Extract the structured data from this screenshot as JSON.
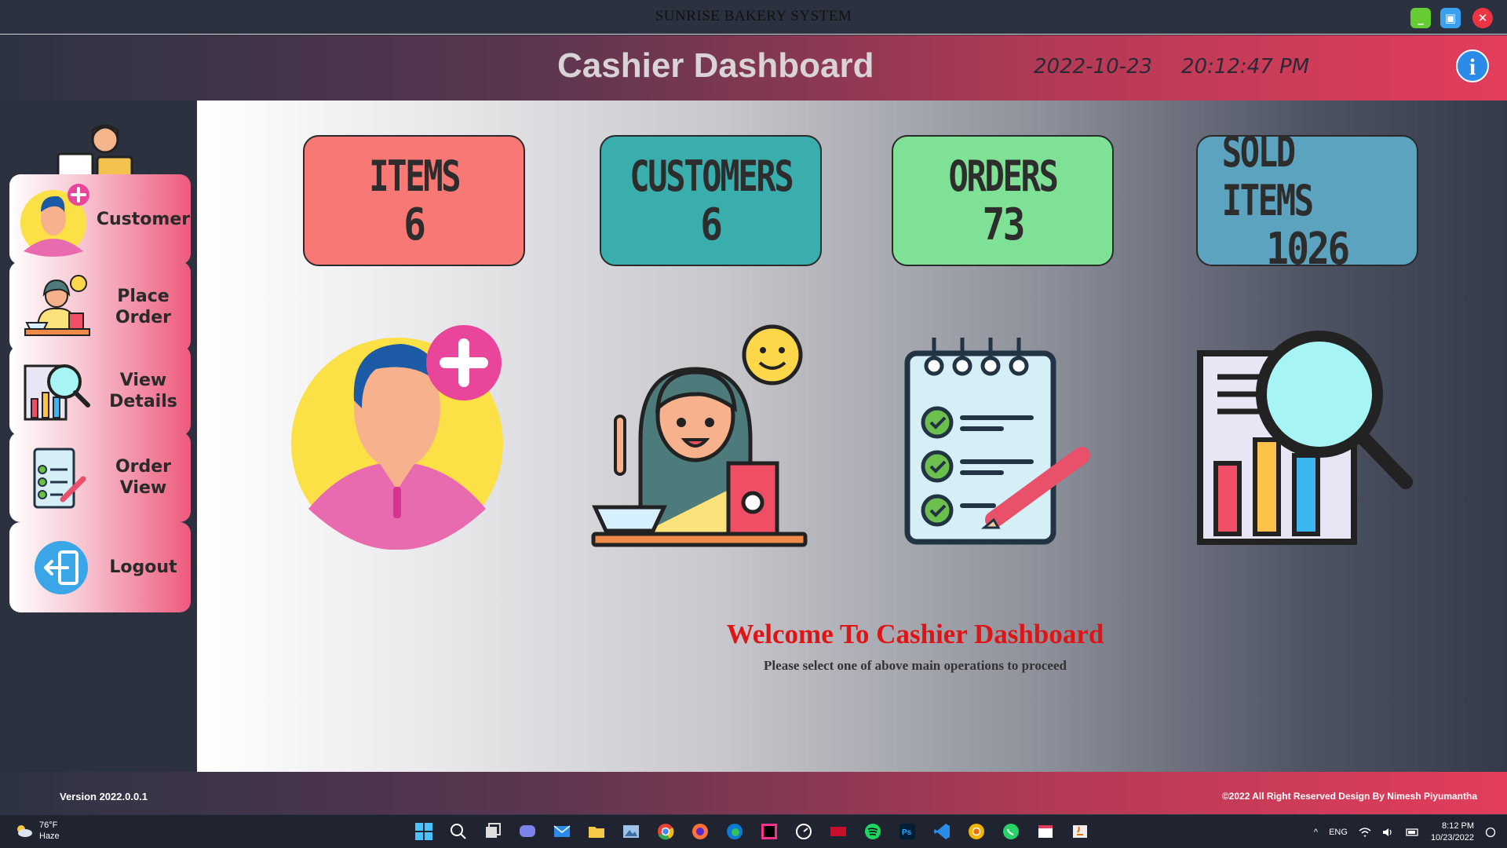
{
  "window": {
    "title": "SUNRISE BAKERY SYSTEM",
    "minimize_icon": "minimize-icon",
    "maximize_icon": "maximize-icon",
    "close_icon": "close-icon"
  },
  "header": {
    "title": "Cashier Dashboard",
    "date": "2022-10-23",
    "time": "20:12:47 PM",
    "info_label": "i"
  },
  "sidebar": {
    "logo_icon": "cashier-icon",
    "items": [
      {
        "label": "Customer",
        "icon": "add-customer-icon"
      },
      {
        "label": "Place\nOrder",
        "icon": "place-order-icon"
      },
      {
        "label": "View\nDetails",
        "icon": "view-details-icon"
      },
      {
        "label": "Order\nView",
        "icon": "order-view-icon"
      },
      {
        "label": "Logout",
        "icon": "logout-icon"
      }
    ]
  },
  "stats": [
    {
      "label": "ITEMS",
      "value": "6",
      "color": "#f77875"
    },
    {
      "label": "CUSTOMERS",
      "value": "6",
      "color": "#3aaead"
    },
    {
      "label": "ORDERS",
      "value": "73",
      "color": "#7ee196"
    },
    {
      "label": "SOLD ITEMS",
      "value": "1026",
      "color": "#5ca3bf"
    }
  ],
  "main_icons": [
    "add-customer-icon",
    "place-order-icon",
    "order-view-icon",
    "view-details-icon"
  ],
  "welcome": {
    "title": "Welcome To Cashier Dashboard",
    "subtitle": "Please select one of above main operations to proceed"
  },
  "footer": {
    "version": "Version 2022.0.0.1",
    "copyright": "©2022  All Right Reserved Design By Nimesh Piyumantha"
  },
  "taskbar": {
    "temperature": "76°F",
    "weather": "Haze",
    "language": "ENG",
    "clock_time": "8:12 PM",
    "clock_date": "10/23/2022"
  },
  "colors": {
    "accent": "#e33d5c",
    "background": "#2c3140",
    "welcome_red": "#e01414"
  }
}
